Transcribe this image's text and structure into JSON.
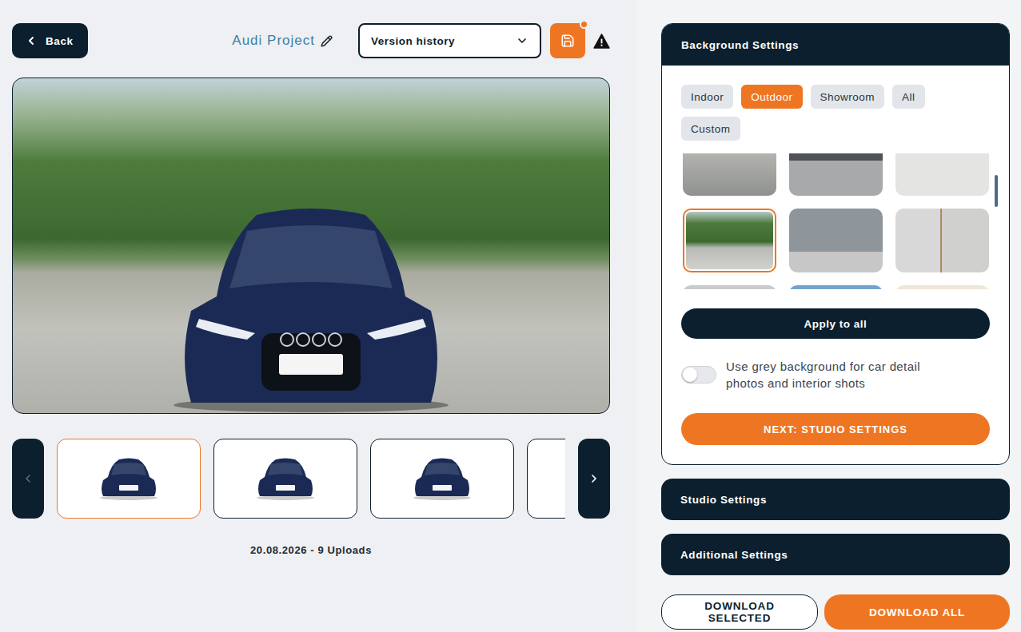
{
  "header": {
    "back": "Back",
    "project": "Audi Project",
    "version_select": {
      "placeholder": "Version history"
    },
    "save": {
      "unsaved": true
    }
  },
  "gallery": {
    "prev": {
      "disabled": true
    },
    "next": {
      "disabled": false
    },
    "thumbnails": [
      {
        "selected": true
      },
      {
        "selected": false
      },
      {
        "selected": false
      },
      {
        "selected": false
      }
    ],
    "footer": "20.08.2026 - 9 Uploads"
  },
  "sections": [
    {
      "title": "Background Settings",
      "expanded": true
    },
    {
      "title": "Studio Settings",
      "expanded": false
    },
    {
      "title": "Additional Settings",
      "expanded": false
    }
  ],
  "background": {
    "categories": [
      {
        "label": "Indoor",
        "selected": false
      },
      {
        "label": "Outdoor",
        "selected": true
      },
      {
        "label": "Showroom",
        "selected": false
      },
      {
        "label": "All",
        "selected": false
      },
      {
        "label": "Custom",
        "selected": false
      }
    ],
    "tiles": [
      {
        "selected": false
      },
      {
        "selected": false
      },
      {
        "selected": false
      },
      {
        "selected": true
      },
      {
        "selected": false
      },
      {
        "selected": false
      },
      {
        "selected": false
      },
      {
        "selected": false
      },
      {
        "selected": false
      }
    ],
    "apply_all": "Apply to all",
    "grey_toggle": {
      "label": "Use grey background for car detail photos and interior shots",
      "on": false
    },
    "next": "NEXT: STUDIO SETTINGS"
  },
  "downloads": [
    {
      "label": "DOWNLOAD SELECTED",
      "kind": "outline"
    },
    {
      "label": "DOWNLOAD ALL",
      "kind": "primary"
    }
  ]
}
